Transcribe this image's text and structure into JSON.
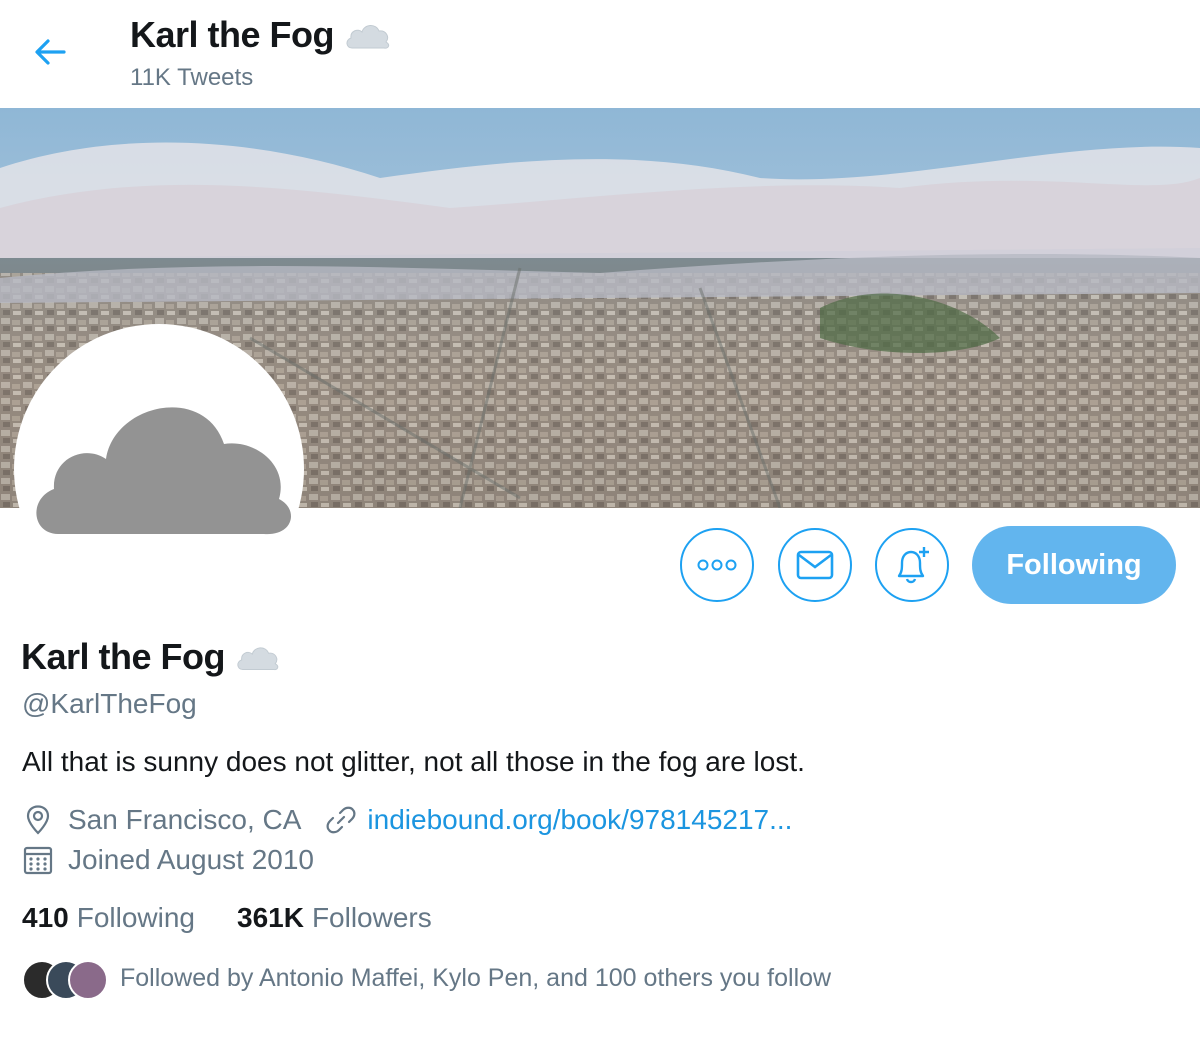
{
  "header": {
    "back_icon": "arrow-left-icon",
    "title": "Karl the Fog",
    "tweet_count": "11K Tweets"
  },
  "banner": {
    "description_icon": "city-fog-banner"
  },
  "actions": {
    "more_icon": "more-dots-icon",
    "message_icon": "envelope-icon",
    "notify_icon": "bell-plus-icon",
    "follow_label": "Following"
  },
  "profile": {
    "name": "Karl the Fog",
    "handle": "@KarlTheFog",
    "bio": "All that is sunny does not glitter, not all those in the fog are lost.",
    "location": "San Francisco, CA",
    "website": "indiebound.org/book/978145217...",
    "joined": "Joined August 2010"
  },
  "stats": {
    "following_count": "410",
    "following_label": "Following",
    "followers_count": "361K",
    "followers_label": "Followers"
  },
  "followed_by": {
    "text": "Followed by Antonio Maffei, Kylo Pen, and 100 others you follow"
  },
  "colors": {
    "accent": "#1da1f2",
    "link": "#1b95e0",
    "follow_button": "#62b5ee",
    "muted": "#657786"
  }
}
